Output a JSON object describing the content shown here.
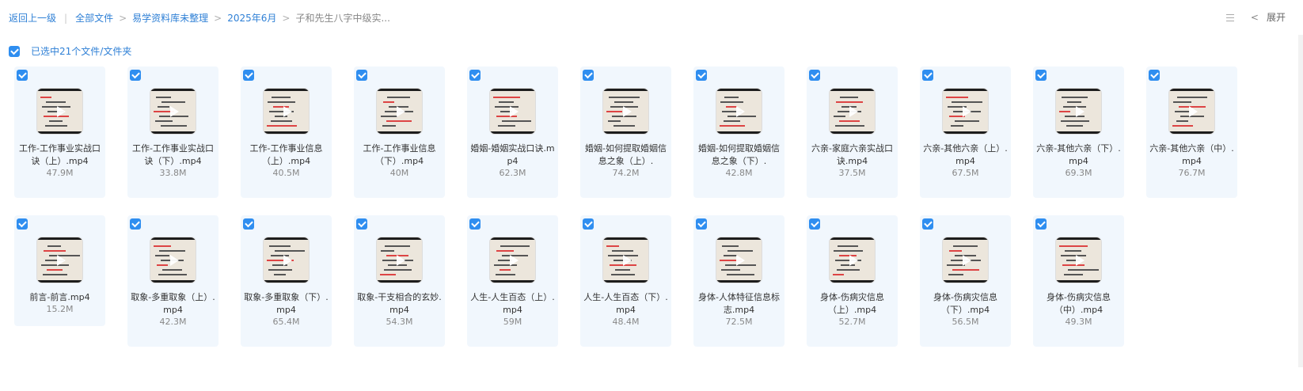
{
  "breadcrumb": {
    "back": "返回上一级",
    "items": [
      "全部文件",
      "易学资料库未整理",
      "2025年6月"
    ],
    "current": "子和先生八字中级实..."
  },
  "toolbar": {
    "expand": "展开"
  },
  "selection": {
    "label": "已选中21个文件/文件夹"
  },
  "files": [
    {
      "name": "工作-工作事业实战口诀（上）.mp4",
      "size": "47.9M"
    },
    {
      "name": "工作-工作事业实战口诀（下）.mp4",
      "size": "33.8M"
    },
    {
      "name": "工作-工作事业信息（上）.mp4",
      "size": "40.5M"
    },
    {
      "name": "工作-工作事业信息（下）.mp4",
      "size": "40M"
    },
    {
      "name": "婚姻-婚姻实战口诀.mp4",
      "size": "62.3M"
    },
    {
      "name": "婚姻-如何提取婚姻信息之象（上）.",
      "size": "74.2M"
    },
    {
      "name": "婚姻-如何提取婚姻信息之象（下）.",
      "size": "42.8M"
    },
    {
      "name": "六亲-家庭六亲实战口诀.mp4",
      "size": "37.5M"
    },
    {
      "name": "六亲-其他六亲（上）.mp4",
      "size": "67.5M"
    },
    {
      "name": "六亲-其他六亲（下）.mp4",
      "size": "69.3M"
    },
    {
      "name": "六亲-其他六亲（中）.mp4",
      "size": "76.7M"
    },
    {
      "name": "前言-前言.mp4",
      "size": "15.2M"
    },
    {
      "name": "取象-多重取象（上）.mp4",
      "size": "42.3M"
    },
    {
      "name": "取象-多重取象（下）.mp4",
      "size": "65.4M"
    },
    {
      "name": "取象-干支相合的玄妙.mp4",
      "size": "54.3M"
    },
    {
      "name": "人生-人生百态（上）.mp4",
      "size": "59M"
    },
    {
      "name": "人生-人生百态（下）.mp4",
      "size": "48.4M"
    },
    {
      "name": "身体-人体特征信息标志.mp4",
      "size": "72.5M"
    },
    {
      "name": "身体-伤病灾信息（上）.mp4",
      "size": "52.7M"
    },
    {
      "name": "身体-伤病灾信息（下）.mp4",
      "size": "56.5M"
    },
    {
      "name": "身体-伤病灾信息（中）.mp4",
      "size": "49.3M"
    }
  ]
}
